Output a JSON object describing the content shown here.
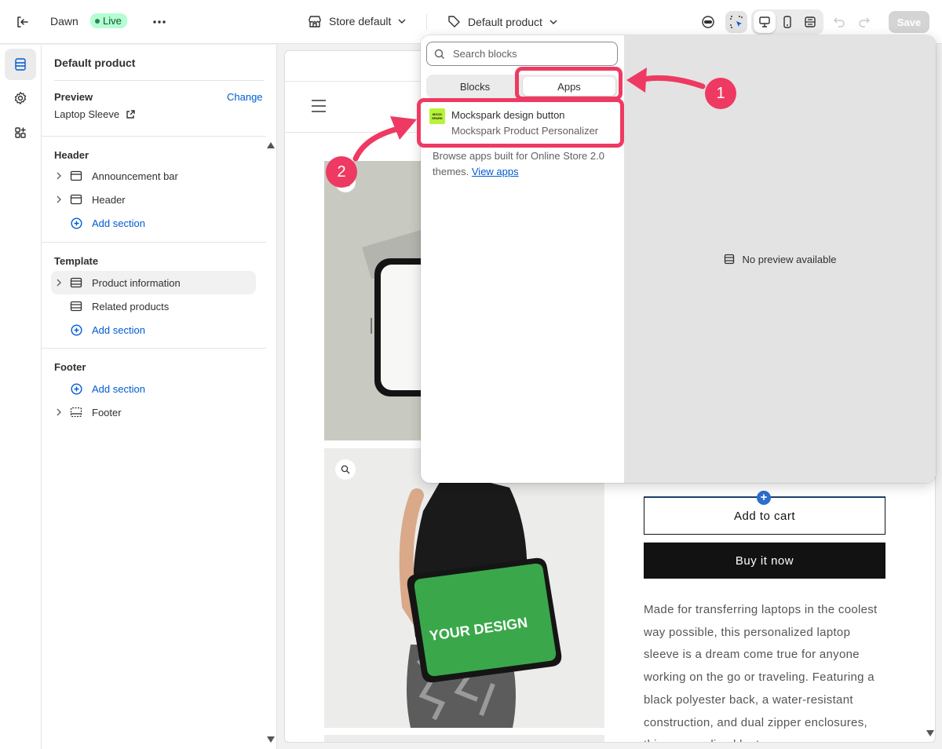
{
  "topbar": {
    "theme_name": "Dawn",
    "live_badge": "Live",
    "store_selector": "Store default",
    "template_selector": "Default product",
    "save_label": "Save"
  },
  "sidebar": {
    "title": "Default product",
    "preview_label": "Preview",
    "change_label": "Change",
    "preview_product": "Laptop Sleeve",
    "sections": [
      {
        "heading": "Header",
        "items": [
          "Announcement bar",
          "Header"
        ],
        "add_label": "Add section"
      },
      {
        "heading": "Template",
        "items": [
          "Product information",
          "Related products"
        ],
        "add_label": "Add section"
      },
      {
        "heading": "Footer",
        "items": [
          "Footer"
        ],
        "add_label": "Add section"
      }
    ]
  },
  "popover": {
    "search_placeholder": "Search blocks",
    "tabs": [
      "Blocks",
      "Apps"
    ],
    "active_tab": "Apps",
    "app_item": {
      "name": "Mockspark design button",
      "subtitle": "Mockspark Product Personalizer",
      "logo_text": "MOCK SPARK"
    },
    "browse_text": "Browse apps built for Online Store 2.0 themes.",
    "browse_link": "View apps",
    "no_preview": "No preview available"
  },
  "product": {
    "add_to_cart": "Add to cart",
    "buy_now": "Buy it now",
    "description": "Made for transferring laptops in the coolest way possible, this personalized laptop sleeve is a dream come true for anyone working on the go or traveling. Featuring a black polyester back, a water-resistant construction, and dual zipper enclosures, this personalized laptop",
    "sleeve_text": "YOUR DESIGN"
  },
  "annotations": {
    "badge_1": "1",
    "badge_2": "2",
    "color": "#ee3a62"
  }
}
